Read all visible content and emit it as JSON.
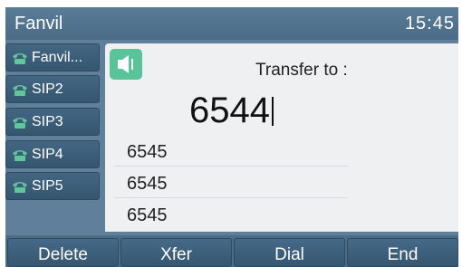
{
  "header": {
    "brand": "Fanvil",
    "time": "15:45"
  },
  "line_keys": [
    {
      "label": "Fanvil...",
      "icon": "phone-icon"
    },
    {
      "label": "SIP2",
      "icon": "phone-icon"
    },
    {
      "label": "SIP3",
      "icon": "phone-icon"
    },
    {
      "label": "SIP4",
      "icon": "phone-icon"
    },
    {
      "label": "SIP5",
      "icon": "phone-icon"
    }
  ],
  "main": {
    "speaker_icon": "speaker-icon",
    "title": "Transfer to :",
    "dial_input": "6544",
    "history": [
      "6545",
      "6545",
      "6545"
    ]
  },
  "softkeys": [
    "Delete",
    "Xfer",
    "Dial",
    "End"
  ],
  "colors": {
    "header": "#4b6b86",
    "panel": "#eef0f2",
    "speaker_badge": "#59c39a",
    "phone_icon": "#5fc79a"
  }
}
